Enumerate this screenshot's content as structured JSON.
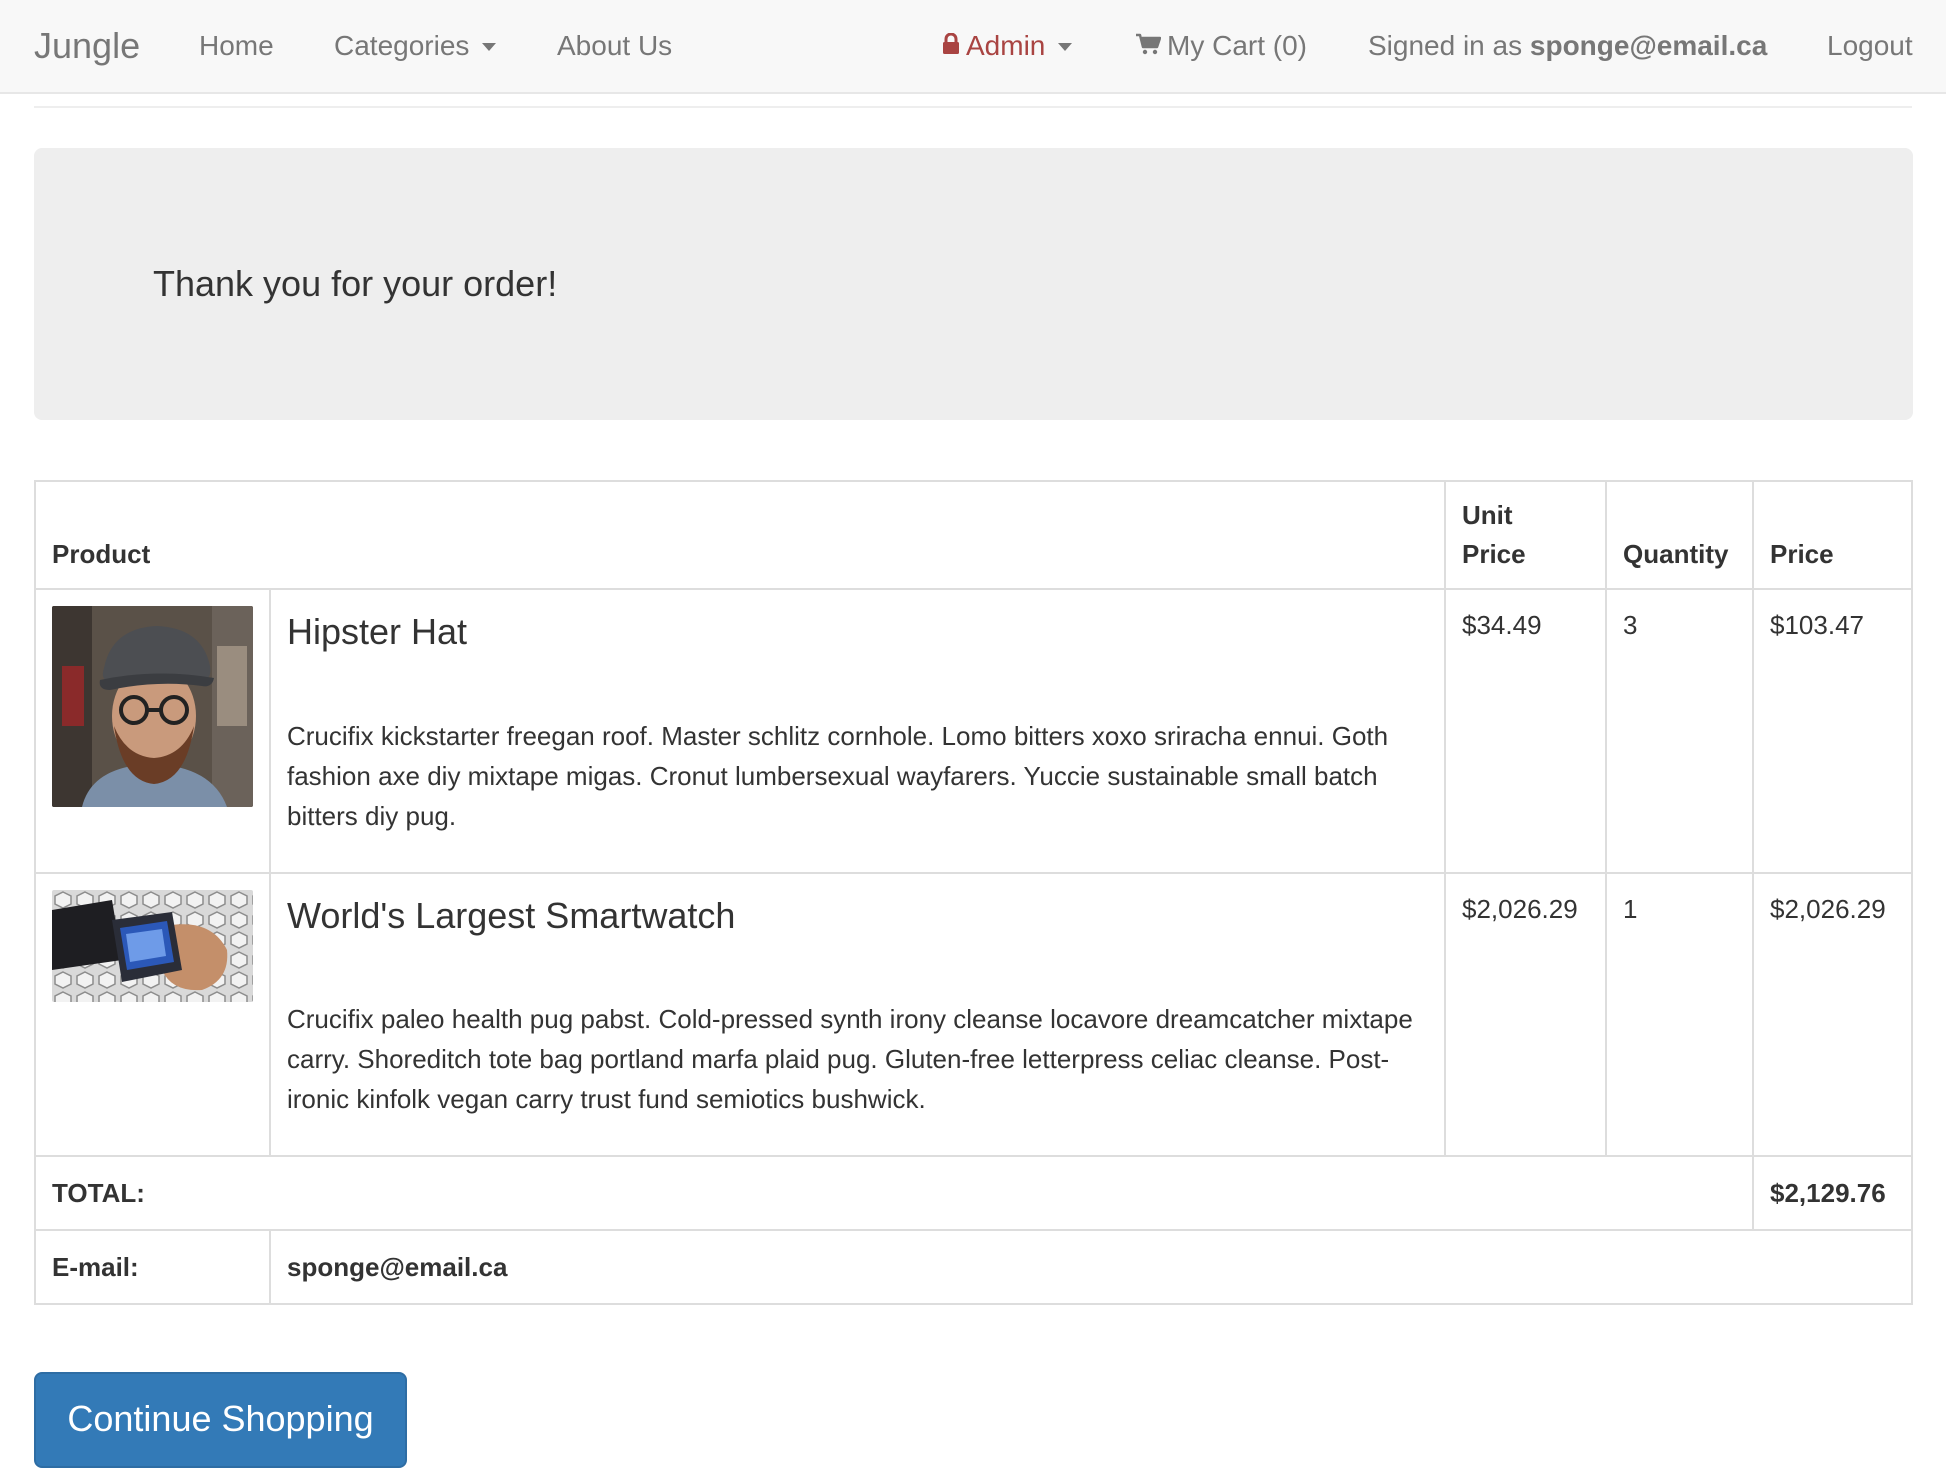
{
  "navbar": {
    "brand": "Jungle",
    "home": "Home",
    "categories": "Categories",
    "about": "About Us",
    "admin": "Admin",
    "cart": "My Cart (0)",
    "signed_prefix": "Signed in as",
    "signed_user": "sponge@email.ca",
    "logout": "Logout"
  },
  "jumbotron": {
    "message": "Thank you for your order!"
  },
  "table": {
    "headers": {
      "product": "Product",
      "unit_price_line1": "Unit",
      "unit_price_line2": "Price",
      "quantity": "Quantity",
      "price": "Price"
    },
    "items": [
      {
        "name": "Hipster Hat",
        "description": "Crucifix kickstarter freegan roof. Master schlitz cornhole. Lomo bitters xoxo sriracha ennui. Goth fashion axe diy mixtape migas. Cronut lumbersexual wayfarers. Yuccie sustainable small batch bitters diy pug.",
        "unit_price": "$34.49",
        "quantity": "3",
        "price": "$103.47"
      },
      {
        "name": "World's Largest Smartwatch",
        "description": "Crucifix paleo health pug pabst. Cold-pressed synth irony cleanse locavore dreamcatcher mixtape carry. Shoreditch tote bag portland marfa plaid pug. Gluten-free letterpress celiac cleanse. Post-ironic kinfolk vegan carry trust fund semiotics bushwick.",
        "unit_price": "$2,026.29",
        "quantity": "1",
        "price": "$2,026.29"
      }
    ],
    "total_label": "TOTAL:",
    "total_value": "$2,129.76",
    "email_label": "E-mail:",
    "email_value": "sponge@email.ca"
  },
  "buttons": {
    "continue_shopping": "Continue Shopping"
  },
  "colors": {
    "primary": "#337ab7",
    "admin": "#a94442",
    "navbar_bg": "#f8f8f8",
    "jumbotron_bg": "#eeeeee"
  },
  "icons": {
    "admin": "lock-icon",
    "cart": "shopping-cart-icon"
  }
}
